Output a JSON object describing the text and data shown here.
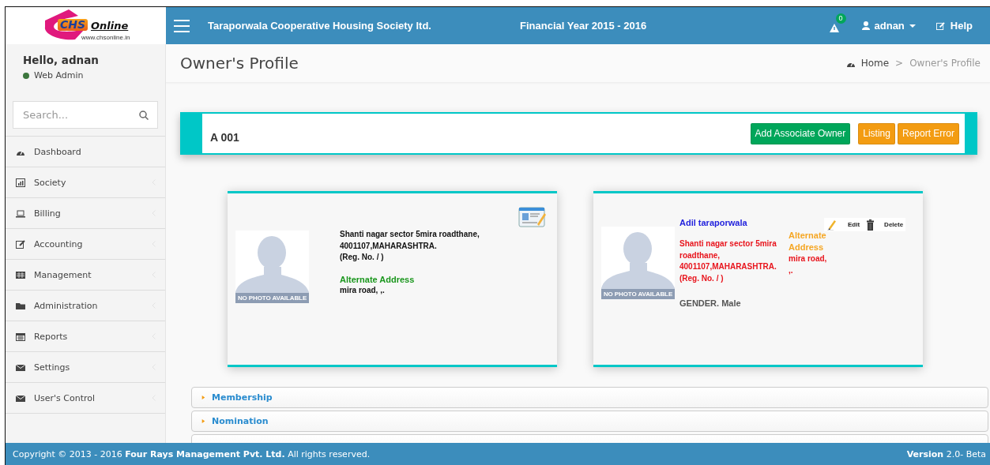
{
  "logo": {
    "mark": "CHS",
    "name": "Online",
    "url": "www.chsonline.in"
  },
  "header": {
    "society": "Taraporwala Cooperative Housing Society ltd.",
    "financial_year": "Financial Year 2015 - 2016",
    "alert_count": "0",
    "user": "adnan",
    "help": "Help"
  },
  "sidebar": {
    "greeting": "Hello, adnan",
    "role": "Web Admin",
    "online": true,
    "search": {
      "placeholder": "Search..."
    },
    "items": [
      {
        "label": "Dashboard",
        "kind": "dashboard",
        "has_submenu": false
      },
      {
        "label": "Society",
        "kind": "chart",
        "has_submenu": true
      },
      {
        "label": "Billing",
        "kind": "laptop",
        "has_submenu": true
      },
      {
        "label": "Accounting",
        "kind": "edit",
        "has_submenu": true
      },
      {
        "label": "Management",
        "kind": "table",
        "has_submenu": true
      },
      {
        "label": "Administration",
        "kind": "folder",
        "has_submenu": true
      },
      {
        "label": "Reports",
        "kind": "calendar",
        "has_submenu": true
      },
      {
        "label": "Settings",
        "kind": "envelope",
        "has_submenu": true
      },
      {
        "label": "User's Control",
        "kind": "envelope",
        "has_submenu": true
      }
    ]
  },
  "page": {
    "title": "Owner's Profile",
    "breadcrumb": [
      "Home",
      "Owner's Profile"
    ],
    "breadcrumb_separator": ">"
  },
  "unit": {
    "name": "A 001",
    "buttons": [
      {
        "label": "Add Associate Owner",
        "kind": "success"
      },
      {
        "label": "Listing",
        "kind": "warning"
      },
      {
        "label": "Report Error",
        "kind": "warning"
      }
    ]
  },
  "cards": [
    {
      "kind": "owner",
      "photo_caption": "NO PHOTO AVAILABLE",
      "address": "Shanti nagar sector 5mira roadthane, 4001107,MAHARASHTRA.",
      "reg_no": "(Reg. No. / )",
      "alternate_title": "Alternate Address",
      "alternate_address": "mira road, ,."
    },
    {
      "kind": "associate",
      "photo_caption": "NO PHOTO AVAILABLE",
      "name": "Adil taraporwala",
      "address": "Shanti nagar sector 5mira roadthane, 4001107,MAHARASHTRA.",
      "reg_no": "(Reg. No. / )",
      "gender": "GENDER. Male",
      "alternate_title": "Alternate Address",
      "alternate_address": "mira road, ,.",
      "actions": [
        "Edit",
        "Delete"
      ]
    }
  ],
  "accordions": [
    {
      "label": "Membership",
      "expanded": false
    },
    {
      "label": "Nomination",
      "expanded": false
    }
  ],
  "footer": {
    "copyright": "Copyright © 2013 - 2016 **Four Rays Management Pvt. Ltd.** All rights reserved.",
    "version": "**Version** 2.0- Beta"
  }
}
